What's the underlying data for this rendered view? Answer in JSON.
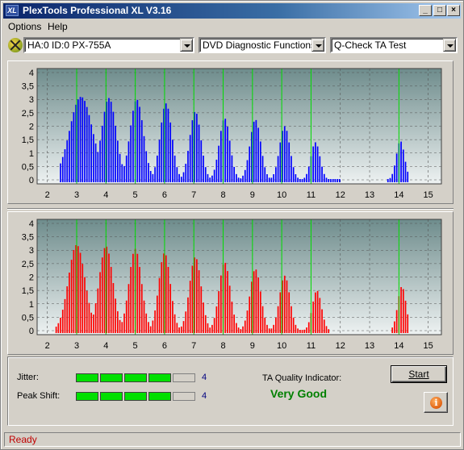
{
  "window": {
    "title": "PlexTools Professional XL V3.16",
    "icon_text": "XL"
  },
  "title_buttons": {
    "minimize": "_",
    "maximize": "□",
    "close": "×"
  },
  "menu": [
    "Options",
    "Help"
  ],
  "toolbar": {
    "drive": "HA:0 ID:0  PX-755A",
    "function": "DVD Diagnostic Functions",
    "test": "Q-Check TA Test"
  },
  "colors": {
    "top_bars": "#0000ff",
    "bottom_bars": "#ff0000",
    "markers": "#00dd00",
    "quality": "#008000",
    "status": "#c00000"
  },
  "chart_data": [
    {
      "type": "bar",
      "series_color": "#0000ff",
      "x_ticks": [
        "2",
        "3",
        "4",
        "5",
        "6",
        "7",
        "8",
        "9",
        "10",
        "11",
        "12",
        "13",
        "14",
        "15"
      ],
      "y_ticks": [
        "0",
        "0,5",
        "1",
        "1,5",
        "2",
        "2,5",
        "3",
        "3,5",
        "4"
      ],
      "xlim": [
        1.65,
        15.45
      ],
      "ylim": [
        -0.15,
        4.15
      ],
      "grid": true,
      "markers": [
        3,
        4,
        5,
        6,
        7,
        8,
        9,
        10,
        11,
        14
      ],
      "peaks": [
        {
          "center": 3.15,
          "height": 3.1,
          "width": 0.55
        },
        {
          "center": 4.1,
          "height": 3.05,
          "width": 0.35
        },
        {
          "center": 5.05,
          "height": 3.0,
          "width": 0.32
        },
        {
          "center": 6.05,
          "height": 2.85,
          "width": 0.28
        },
        {
          "center": 7.05,
          "height": 2.55,
          "width": 0.27
        },
        {
          "center": 8.05,
          "height": 2.3,
          "width": 0.26
        },
        {
          "center": 9.1,
          "height": 2.25,
          "width": 0.26
        },
        {
          "center": 10.1,
          "height": 2.0,
          "width": 0.25
        },
        {
          "center": 11.15,
          "height": 1.4,
          "width": 0.22
        },
        {
          "center": 14.05,
          "height": 1.45,
          "width": 0.2
        }
      ],
      "ranges": [
        [
          2.4,
          12.0
        ],
        [
          13.6,
          14.3
        ]
      ]
    },
    {
      "type": "bar",
      "series_color": "#ff0000",
      "x_ticks": [
        "2",
        "3",
        "4",
        "5",
        "6",
        "7",
        "8",
        "9",
        "10",
        "11",
        "12",
        "13",
        "14",
        "15"
      ],
      "y_ticks": [
        "0",
        "0,5",
        "1",
        "1,5",
        "2",
        "2,5",
        "3",
        "3,5",
        "4"
      ],
      "xlim": [
        1.65,
        15.45
      ],
      "ylim": [
        -0.15,
        4.15
      ],
      "grid": true,
      "markers": [
        3,
        4,
        5,
        6,
        7,
        8,
        9,
        10,
        11,
        14
      ],
      "peaks": [
        {
          "center": 3.0,
          "height": 3.2,
          "width": 0.4
        },
        {
          "center": 4.0,
          "height": 3.15,
          "width": 0.33
        },
        {
          "center": 5.0,
          "height": 3.05,
          "width": 0.3
        },
        {
          "center": 6.0,
          "height": 2.9,
          "width": 0.28
        },
        {
          "center": 7.05,
          "height": 2.75,
          "width": 0.28
        },
        {
          "center": 8.05,
          "height": 2.55,
          "width": 0.27
        },
        {
          "center": 9.1,
          "height": 2.3,
          "width": 0.26
        },
        {
          "center": 10.1,
          "height": 2.05,
          "width": 0.25
        },
        {
          "center": 11.2,
          "height": 1.5,
          "width": 0.22
        },
        {
          "center": 14.1,
          "height": 1.65,
          "width": 0.2
        }
      ],
      "ranges": [
        [
          2.3,
          11.6
        ],
        [
          13.7,
          14.35
        ]
      ]
    }
  ],
  "metrics": {
    "jitter": {
      "label": "Jitter:",
      "value": 4,
      "display": "4",
      "max": 5
    },
    "peak_shift": {
      "label": "Peak Shift:",
      "value": 4,
      "display": "4",
      "max": 5
    }
  },
  "quality": {
    "label": "TA Quality Indicator:",
    "value": "Very Good"
  },
  "buttons": {
    "start": "Start",
    "info_icon": "i"
  },
  "status": "Ready"
}
